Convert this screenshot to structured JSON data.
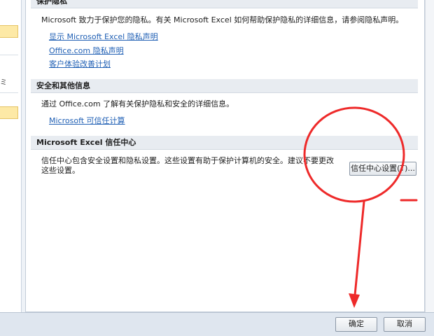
{
  "left_nav": {
    "fragment_text": "ミ"
  },
  "privacy": {
    "header": "保护隐私",
    "description": "Microsoft 致力于保护您的隐私。有关 Microsoft Excel 如何帮助保护隐私的详细信息，请参阅隐私声明。",
    "links": [
      "显示 Microsoft Excel 隐私声明",
      "Office.com 隐私声明",
      "客户体验改善计划"
    ]
  },
  "security": {
    "header": "安全和其他信息",
    "description": "通过 Office.com 了解有关保护隐私和安全的详细信息。",
    "link": "Microsoft 可信任计算"
  },
  "trust_center": {
    "header": "Microsoft Excel 信任中心",
    "description_line1": "信任中心包含安全设置和隐私设置。这些设置有助于保护计算机的安全。建议不要更改",
    "description_line2": "这些设置。",
    "button_label": "信任中心设置(T)..."
  },
  "footer": {
    "ok_label": "确定",
    "cancel_label": "取消"
  },
  "colors": {
    "annotation": "#ee2a2a",
    "link": "#1f5fb4",
    "header_bg": "#e8ecf1"
  }
}
